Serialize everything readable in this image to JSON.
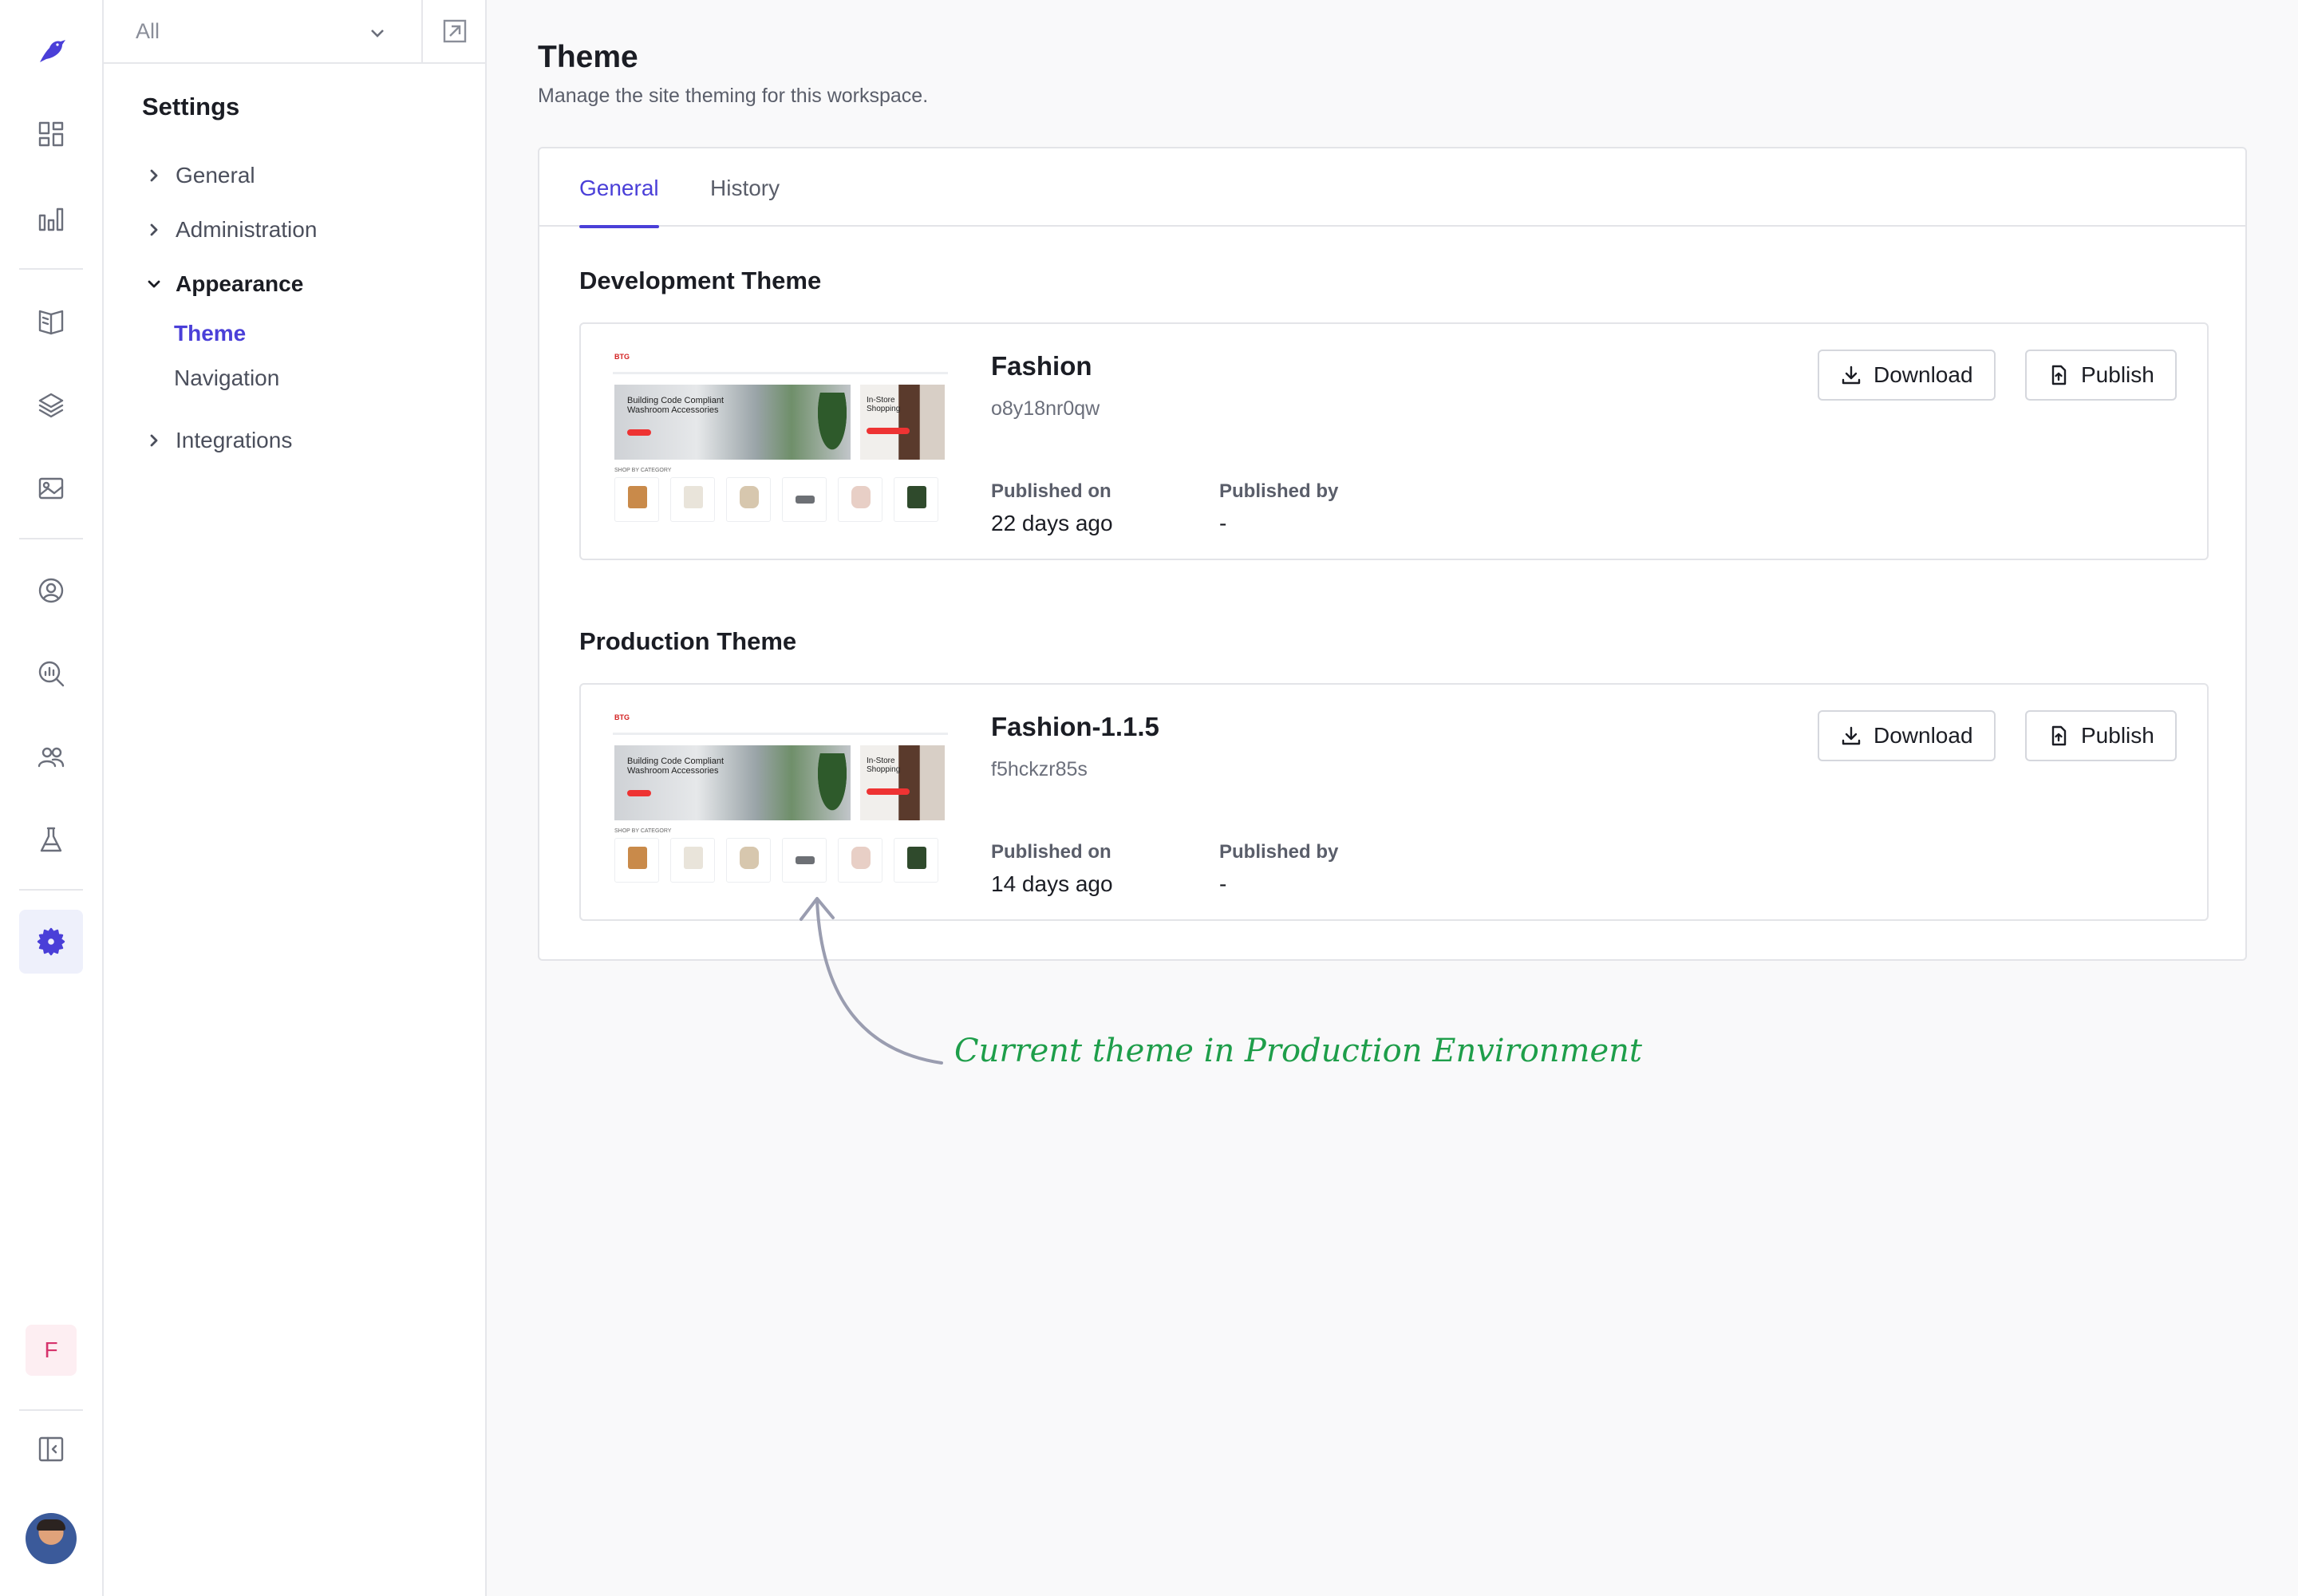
{
  "rail": {
    "org_initial": "F",
    "icons": [
      "logo-bird-icon",
      "dashboard-icon",
      "analytics-icon",
      "catalog-book-icon",
      "layers-icon",
      "media-image-icon",
      "customers-icon",
      "search-insights-icon",
      "team-users-icon",
      "experiments-flask-icon",
      "settings-gear-icon",
      "collapse-sidebar-icon"
    ],
    "accent": "#4a3fd8"
  },
  "sidebar": {
    "scope_value": "All",
    "title": "Settings",
    "items": [
      {
        "label": "General",
        "expanded": false
      },
      {
        "label": "Administration",
        "expanded": false
      },
      {
        "label": "Appearance",
        "expanded": true,
        "children": [
          {
            "label": "Theme",
            "active": true
          },
          {
            "label": "Navigation",
            "active": false
          }
        ]
      },
      {
        "label": "Integrations",
        "expanded": false
      }
    ]
  },
  "page": {
    "title": "Theme",
    "subtitle": "Manage the site theming for this workspace."
  },
  "tabs": [
    {
      "label": "General",
      "active": true
    },
    {
      "label": "History",
      "active": false
    }
  ],
  "development": {
    "section_title": "Development Theme",
    "name": "Fashion",
    "id": "o8y18nr0qw",
    "published_on_label": "Published on",
    "published_on": "22 days ago",
    "published_by_label": "Published by",
    "published_by": "-",
    "download_label": "Download",
    "publish_label": "Publish"
  },
  "production": {
    "section_title": "Production Theme",
    "name": "Fashion-1.1.5",
    "id": "f5hckzr85s",
    "published_on_label": "Published on",
    "published_on": "14 days ago",
    "published_by_label": "Published by",
    "published_by": "-",
    "download_label": "Download",
    "publish_label": "Publish"
  },
  "thumbnail": {
    "logo": "BTG",
    "hero_text": "Building Code Compliant Washroom Accessories",
    "promo_text": "In-Store Shopping",
    "category_label": "SHOP BY CATEGORY"
  },
  "annotation": {
    "text": "Current theme in Production Environment",
    "color": "#1e9e4a"
  }
}
